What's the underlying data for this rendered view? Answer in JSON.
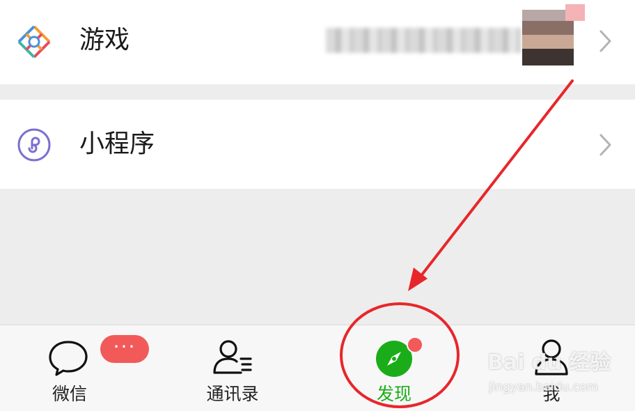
{
  "menu": {
    "games": {
      "label": "游戏",
      "icon": "games-icon"
    },
    "mini_programs": {
      "label": "小程序",
      "icon": "mini-program-icon"
    }
  },
  "tabbar": {
    "chat": {
      "label": "微信",
      "badge": "···",
      "icon": "chat-icon"
    },
    "contacts": {
      "label": "通讯录",
      "icon": "contacts-icon"
    },
    "discover": {
      "label": "发现",
      "icon": "compass-icon",
      "active": true
    },
    "me": {
      "label": "我",
      "icon": "person-icon"
    }
  },
  "watermark": {
    "brand": "Bai du 经验",
    "url": "jingyan.baidu.com"
  },
  "colors": {
    "accent_green": "#1aad19",
    "badge_red": "#f25a5a",
    "annotation_red": "#e8262a",
    "background": "#ededed"
  }
}
